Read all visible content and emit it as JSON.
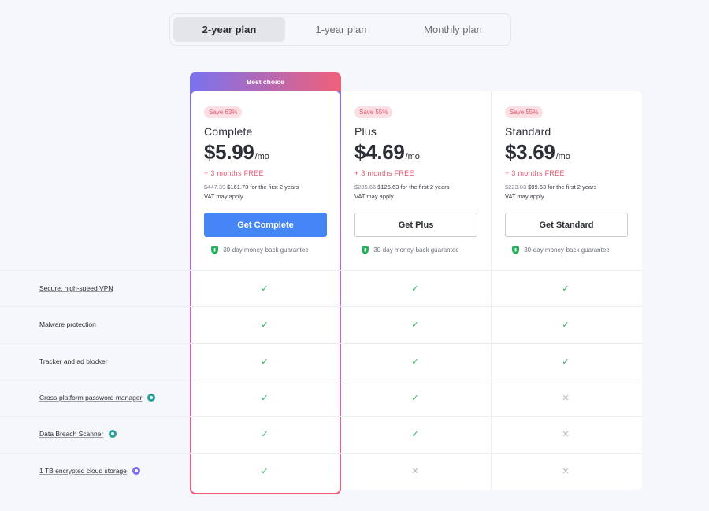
{
  "tabs": [
    {
      "label": "2-year plan",
      "active": true
    },
    {
      "label": "1-year plan",
      "active": false
    },
    {
      "label": "Monthly plan",
      "active": false
    }
  ],
  "badge": "Best choice",
  "colors": {
    "accent": "#4585f5",
    "save_bg": "#fcdfe3",
    "save_text": "#e4566f",
    "check": "#28b05c",
    "cross": "#b2b6be",
    "gradient_top": "#7a72ee",
    "gradient_bottom": "#f0607a"
  },
  "plans": [
    {
      "save": "Save 63%",
      "name": "Complete",
      "price": "$5.99",
      "per": "/mo",
      "free": "+ 3 months FREE",
      "original": "$447.39",
      "billing": " $161.73 for the first 2 years",
      "vat": "VAT may apply",
      "cta": "Get Complete",
      "guarantee": "30-day money-back guarantee"
    },
    {
      "save": "Save 55%",
      "name": "Plus",
      "price": "$4.69",
      "per": "/mo",
      "free": "+ 3 months FREE",
      "original": "$285.66",
      "billing": " $126.63 for the first 2 years",
      "vat": "VAT may apply",
      "cta": "Get Plus",
      "guarantee": "30-day money-back guarantee"
    },
    {
      "save": "Save 55%",
      "name": "Standard",
      "price": "$3.69",
      "per": "/mo",
      "free": "+ 3 months FREE",
      "original": "$223.83",
      "billing": " $99.63 for the first 2 years",
      "vat": "VAT may apply",
      "cta": "Get Standard",
      "guarantee": "30-day money-back guarantee"
    }
  ],
  "features": [
    {
      "label": "Secure, high-speed VPN",
      "icon": null,
      "availability": [
        true,
        true,
        true
      ]
    },
    {
      "label": "Malware protection",
      "icon": null,
      "availability": [
        true,
        true,
        true
      ]
    },
    {
      "label": "Tracker and ad blocker",
      "icon": null,
      "availability": [
        true,
        true,
        true
      ]
    },
    {
      "label": "Cross-platform password manager",
      "icon": "teal-app-icon",
      "availability": [
        true,
        true,
        false
      ]
    },
    {
      "label": "Data Breach Scanner",
      "icon": "teal-app-icon",
      "availability": [
        true,
        true,
        false
      ]
    },
    {
      "label": "1 TB encrypted cloud storage",
      "icon": "purple-app-icon",
      "availability": [
        true,
        false,
        false
      ]
    }
  ],
  "marks": {
    "check": "✓",
    "cross": "✕"
  }
}
